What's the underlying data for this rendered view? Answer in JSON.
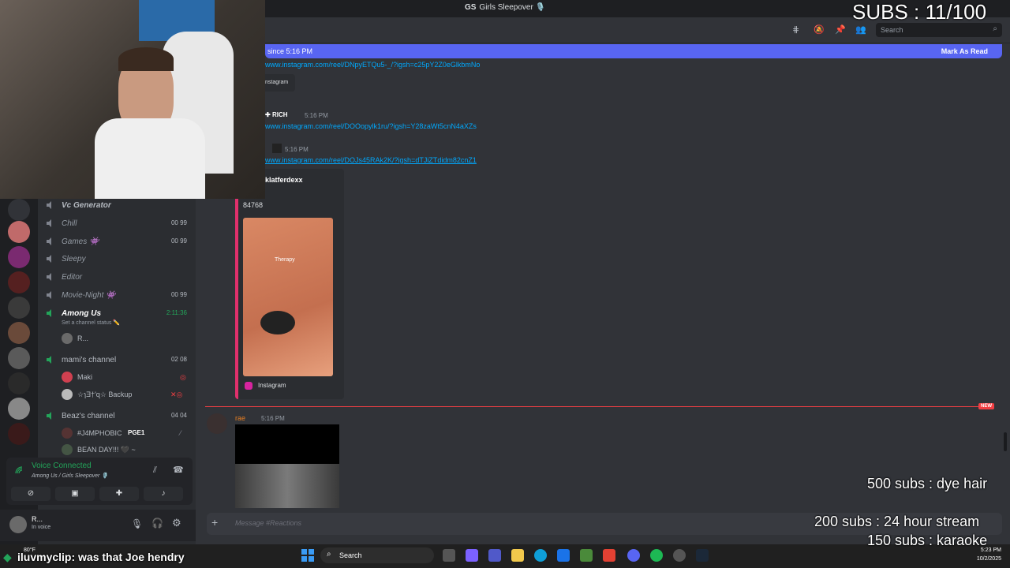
{
  "window": {
    "server_badge": "GS",
    "title": "Girls Sleepover 🎙️"
  },
  "header": {
    "search_placeholder": "Search",
    "icons": [
      "threads-icon",
      "mute-icon",
      "pin-icon",
      "members-icon"
    ]
  },
  "banner": {
    "text": "since 5:16 PM",
    "mark_read": "Mark As Read"
  },
  "channels": [
    {
      "name": "Vc Generator",
      "counts": ""
    },
    {
      "name": "Chill",
      "counts": "00  99"
    },
    {
      "name": "Games 👾",
      "counts": "00  99"
    },
    {
      "name": "Sleepy",
      "counts": ""
    },
    {
      "name": "Editor",
      "counts": ""
    },
    {
      "name": "Movie-Night 👾",
      "counts": "00  99"
    },
    {
      "name": "Among Us",
      "counts": "2:11:36",
      "status": "Set a channel status ✏️"
    },
    {
      "name": "mami's channel",
      "counts": "02  08"
    },
    {
      "name": "Beaz's channel",
      "counts": "04  04"
    }
  ],
  "voice_members": {
    "among_us": [
      "R..."
    ],
    "mamis": [
      "Maki",
      "☆ɿƎ†'ɋ☆ Backup"
    ],
    "beaz": [
      "#J4MPHOBIC",
      "BEAN DAY!!! 🖤 ~"
    ]
  },
  "member_tag": "PGE1",
  "voice_panel": {
    "status": "Voice Connected",
    "location": "Among Us / Girls Sleepover 🎙️"
  },
  "user": {
    "name": "R...",
    "status": "In voice"
  },
  "messages": [
    {
      "link": "www.instagram.com/reel/DNpyETQu5-_/?igsh=c25pY2Z0eGlkbmNo",
      "embed_site": "nstagram"
    },
    {
      "author": "RICH",
      "time": "5:16 PM",
      "link": "www.instagram.com/reel/DOOopylk1ru/?igsh=Y28zaWt5cnN4aXZs"
    },
    {
      "time": "5:16 PM",
      "link": "www.instagram.com/reel/DOJs45RAk2K/?igsh=dTJiZTdidm82cnZ1",
      "embed_author": "klatferdexx",
      "embed_text": "84768",
      "embed_image_caption": "Therapy",
      "embed_footer": "Instagram"
    },
    {
      "author": "rae",
      "time": "5:16 PM"
    }
  ],
  "new_label": "NEW",
  "input": {
    "placeholder": "Message #Reactions"
  },
  "taskbar": {
    "search": "Search",
    "weather": "80°F",
    "time": "5:23 PM",
    "date": "10/2/2025"
  },
  "overlay": {
    "subs": "SUBS : 11/100",
    "goal1": "500 subs : dye hair",
    "goal2": "200 subs : 24 hour stream",
    "goal3": "150 subs : karaoke",
    "chat_user": "iluvmyclip",
    "chat_msg": ": was that Joe hendry"
  },
  "colors": {
    "accent": "#5865f2",
    "link": "#00a8fc",
    "green": "#23a55a",
    "red": "#f23f43",
    "new": "#f23f43"
  }
}
